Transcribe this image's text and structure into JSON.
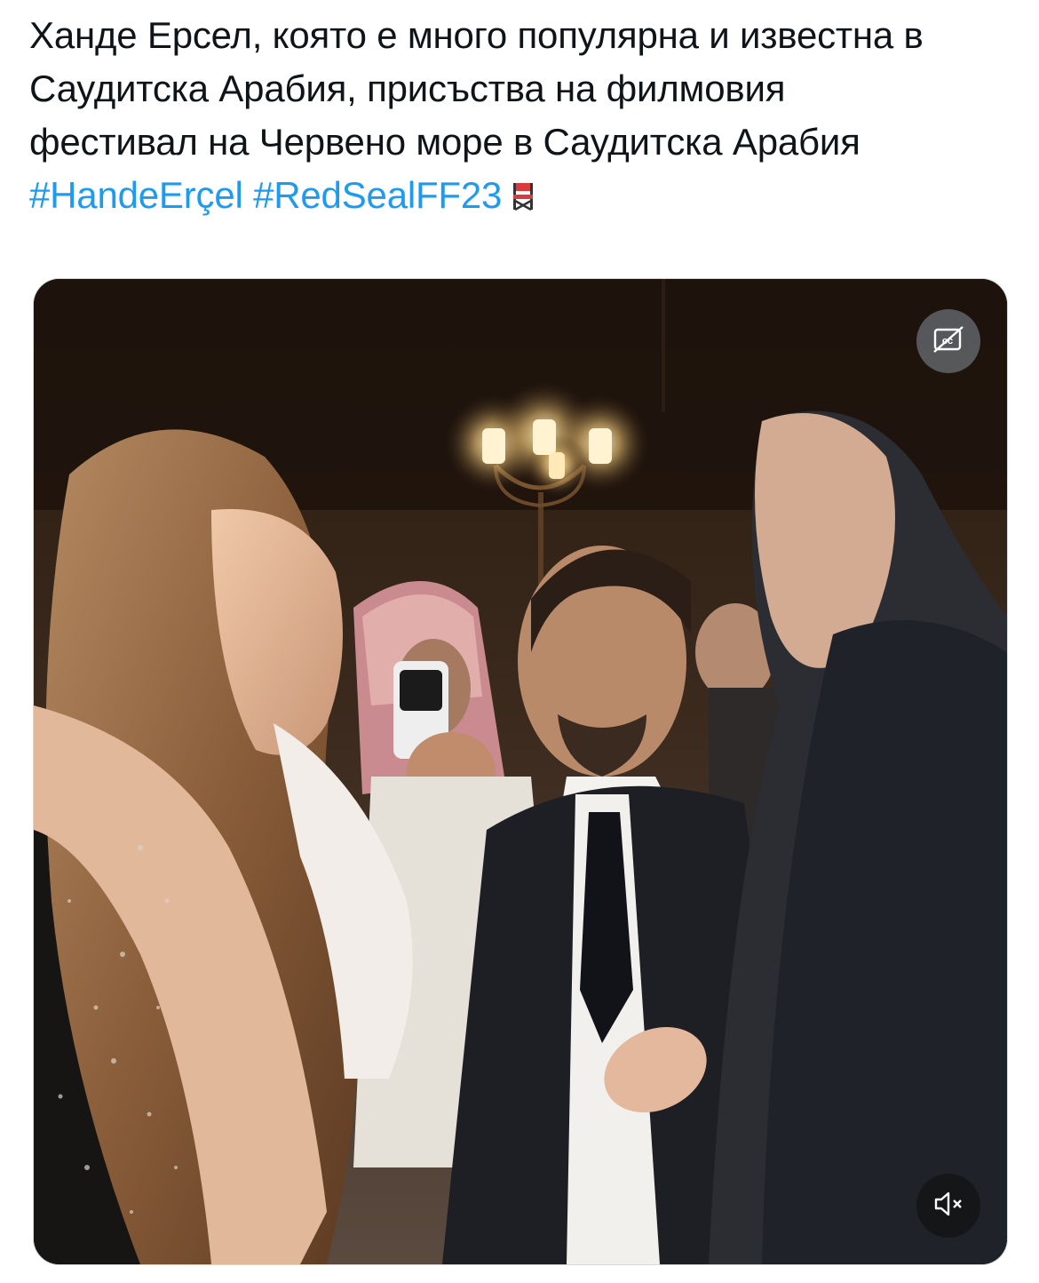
{
  "tweet": {
    "lines": [
      "Ханде Ерсел, която е много популярна и известна в",
      "Саудитска Арабия, присъства на филмовия",
      "фестивал на Червено море в Саудитска Арабия"
    ],
    "hashtags": [
      "#HandeErçel",
      "#RedSealFF23"
    ],
    "emoji_icon": "director-chair-icon"
  },
  "media": {
    "type": "video",
    "controls": {
      "captions_icon": "captions-off-icon",
      "mute_icon": "speaker-muted-icon"
    }
  },
  "colors": {
    "text": "#0f1419",
    "link": "#1d9bf0",
    "overlay_button": "#606468"
  }
}
